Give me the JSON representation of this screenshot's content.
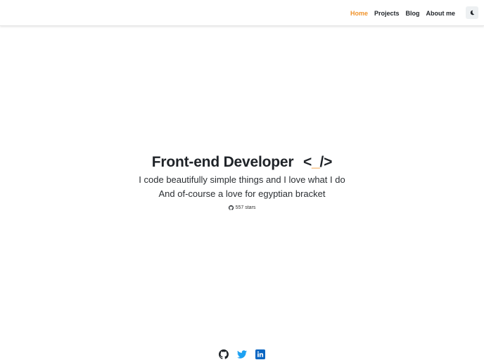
{
  "nav": {
    "items": [
      {
        "label": "Home",
        "active": true
      },
      {
        "label": "Projects",
        "active": false
      },
      {
        "label": "Blog",
        "active": false
      },
      {
        "label": "About me",
        "active": false
      }
    ],
    "theme_toggle_icon": "moon-icon"
  },
  "hero": {
    "title": "Front-end Developer",
    "code_open": "<",
    "code_cursor": "_",
    "code_close": "/>",
    "line1": "I code beautifully simple things and I love what I do",
    "line2": "And of-course a love for egyptian bracket",
    "stars": "557 stars",
    "stars_icon": "github-icon"
  },
  "socials": [
    {
      "name": "github-icon"
    },
    {
      "name": "twitter-icon"
    },
    {
      "name": "linkedin-icon"
    }
  ],
  "colors": {
    "accent": "#f0932b",
    "text": "#1f2328",
    "twitter": "#1da1f2",
    "linkedin": "#0a66c2"
  }
}
